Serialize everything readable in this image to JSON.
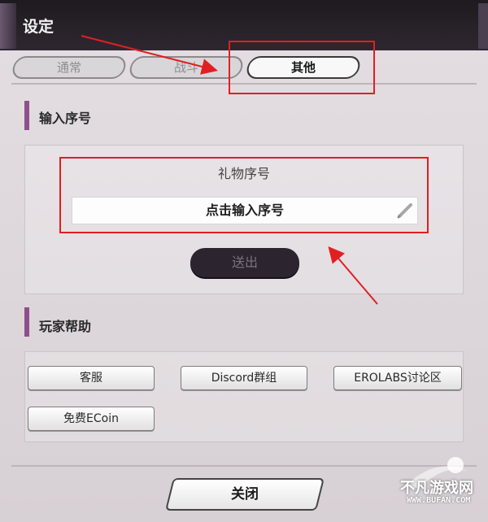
{
  "window": {
    "title": "设定"
  },
  "tabs": [
    {
      "label": "通常",
      "active": false
    },
    {
      "label": "战斗",
      "active": false
    },
    {
      "label": "其他",
      "active": true
    }
  ],
  "serial_section": {
    "title": "输入序号",
    "gift_label": "礼物序号",
    "input_placeholder": "点击输入序号",
    "send_label": "送出"
  },
  "help_section": {
    "title": "玩家帮助",
    "buttons": [
      {
        "label": "客服"
      },
      {
        "label": "Discord群组"
      },
      {
        "label": "EROLABS讨论区"
      },
      {
        "label": "免费ECoin"
      }
    ]
  },
  "footer": {
    "close_label": "关闭"
  },
  "watermark": {
    "text": "不凡游戏网",
    "url": "WWW.BUFAN.COM"
  },
  "colors": {
    "accent": "#8e4f8c",
    "annotation": "#e11f23",
    "titlebar": "#231e24"
  }
}
